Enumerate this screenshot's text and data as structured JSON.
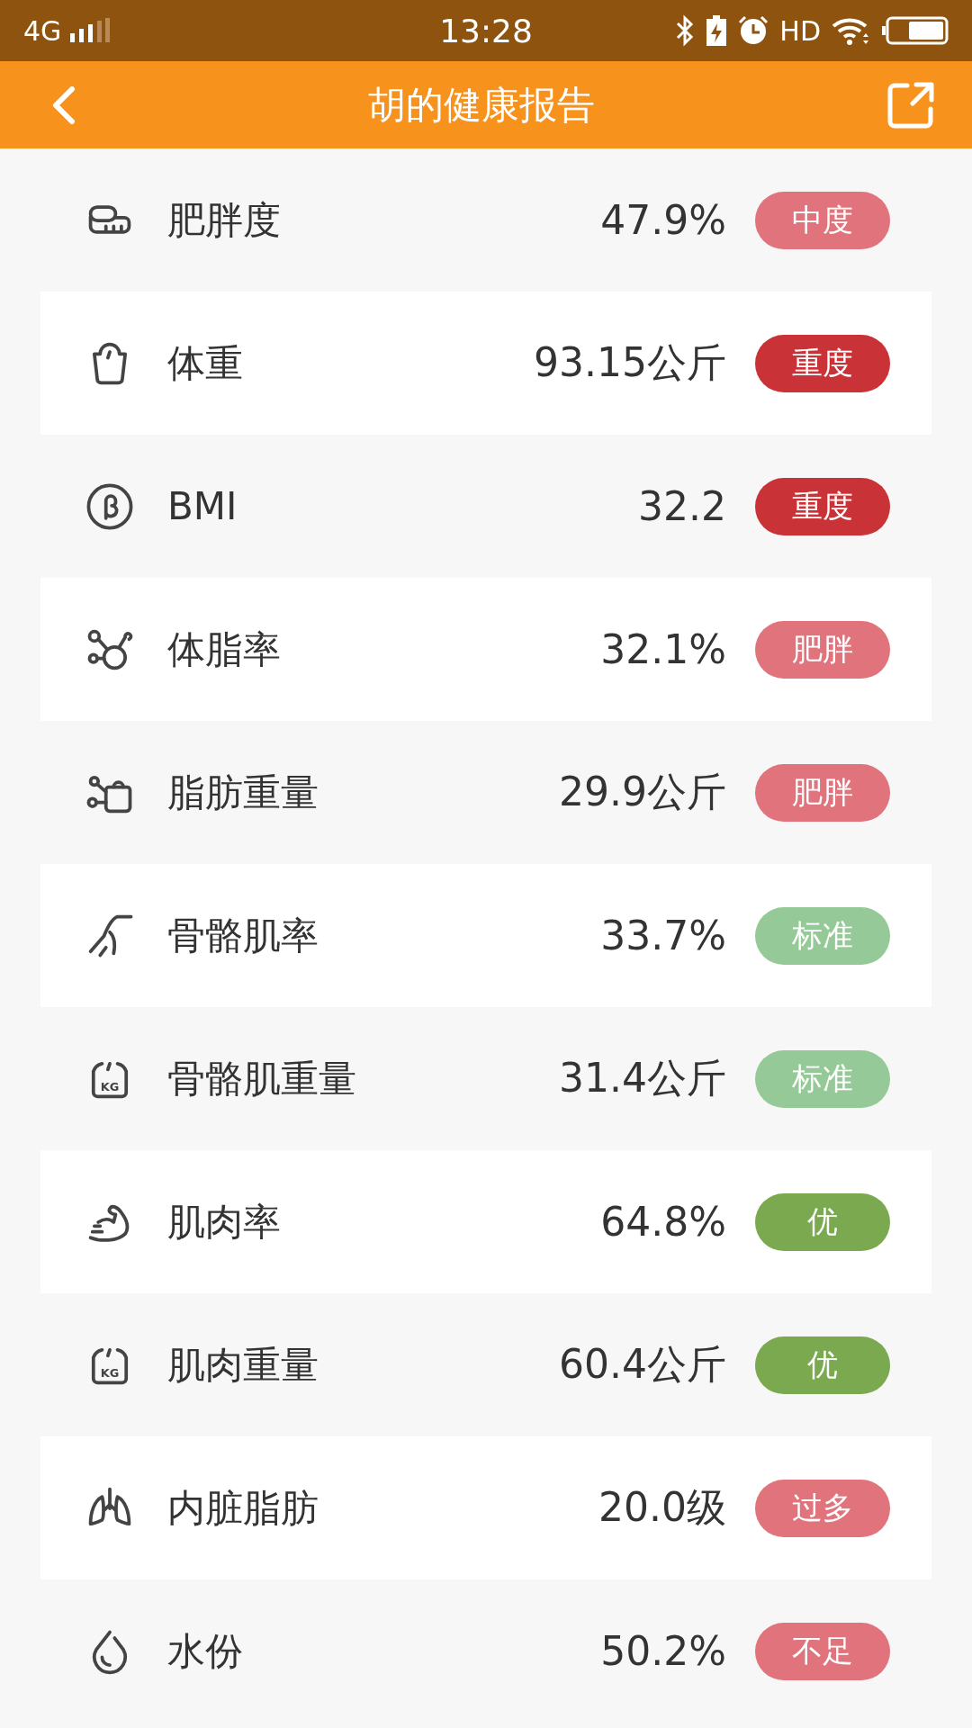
{
  "status_bar": {
    "network": "4G",
    "time": "13:28",
    "hd": "HD"
  },
  "header": {
    "title": "胡的健康报告"
  },
  "rows": [
    {
      "kind": "tape",
      "label": "肥胖度",
      "value": "47.9%",
      "badge": "中度",
      "color": "#e0737c"
    },
    {
      "kind": "scale",
      "label": "体重",
      "value": "93.15公斤",
      "badge": "重度",
      "color": "#c93236"
    },
    {
      "kind": "bmi",
      "label": "BMI",
      "value": "32.2",
      "badge": "重度",
      "color": "#c93236"
    },
    {
      "kind": "fat",
      "label": "体脂率",
      "value": "32.1%",
      "badge": "肥胖",
      "color": "#e0737c"
    },
    {
      "kind": "fatweight",
      "label": "脂肪重量",
      "value": "29.9公斤",
      "badge": "肥胖",
      "color": "#e0737c"
    },
    {
      "kind": "leg",
      "label": "骨骼肌率",
      "value": "33.7%",
      "badge": "标准",
      "color": "#95c997"
    },
    {
      "kind": "kg",
      "icon_text": "KG",
      "label": "骨骼肌重量",
      "value": "31.4公斤",
      "badge": "标准",
      "color": "#95c997"
    },
    {
      "kind": "muscle",
      "label": "肌肉率",
      "value": "64.8%",
      "badge": "优",
      "color": "#7aa94f"
    },
    {
      "kind": "kg",
      "icon_text": "KG",
      "label": "肌肉重量",
      "value": "60.4公斤",
      "badge": "优",
      "color": "#7aa94f"
    },
    {
      "kind": "lungs",
      "label": "内脏脂肪",
      "value": "20.0级",
      "badge": "过多",
      "color": "#e0737c"
    },
    {
      "kind": "drop",
      "label": "水份",
      "value": "50.2%",
      "badge": "不足",
      "color": "#e0737c"
    }
  ]
}
